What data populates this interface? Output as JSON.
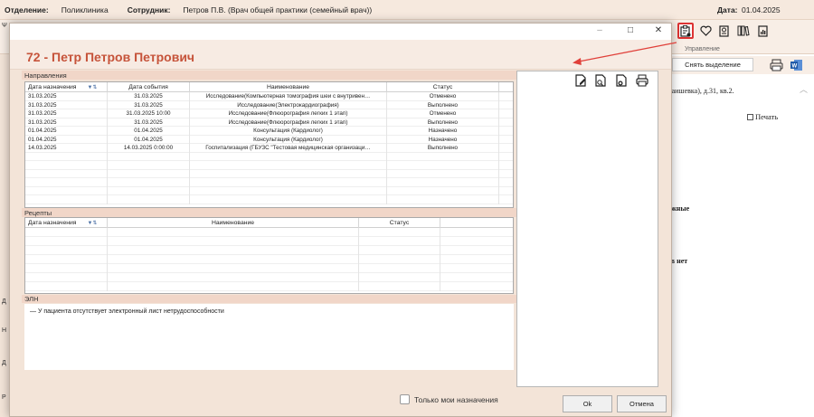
{
  "app": {
    "department_label": "Отделение:",
    "department_value": "Поликлиника",
    "employee_label": "Сотрудник:",
    "employee_value": "Петров П.В. (Врач общей практики (семейный врач))",
    "date_label": "Дата:",
    "date_value": "01.04.2025",
    "ribbon_group_label": "Управление",
    "clear_selection": "Снять выделение",
    "print_label": "Печать",
    "doc_lines": [
      "Баишевка), д.31, кв.2.",
      "ажные",
      "ов нет"
    ]
  },
  "modal": {
    "title": "72 - Петр Петров Петрович",
    "directions": {
      "label": "Направления",
      "columns": [
        "Дата назначения",
        "Дата события",
        "Наименование",
        "Статус"
      ],
      "rows": [
        [
          "31.03.2025",
          "31.03.2025",
          "Исследование(Компьютерная томография шеи с внутривен…",
          "Отменено"
        ],
        [
          "31.03.2025",
          "31.03.2025",
          "Исследование(Электрокардиография)",
          "Выполнено"
        ],
        [
          "31.03.2025",
          "31.03.2025 10:00",
          "Исследование(Флюорография легких 1 этап)",
          "Отменено"
        ],
        [
          "31.03.2025",
          "31.03.2025",
          "Исследование(Флюорография легких 1 этап)",
          "Выполнено"
        ],
        [
          "01.04.2025",
          "01.04.2025",
          "Консультация (Кардиолог)",
          "Назначено"
        ],
        [
          "01.04.2025",
          "01.04.2025",
          "Консультация (Кардиолог)",
          "Назначено"
        ],
        [
          "14.03.2025",
          "14.03.2025 0:00:00",
          "Госпитализация (ГБУЗС \"Тестовая медицинская организаци…",
          "Выполнено"
        ]
      ]
    },
    "recipes": {
      "label": "Рецепты",
      "columns": [
        "Дата назначения",
        "Наименование",
        "Статус"
      ]
    },
    "eln": {
      "label": "ЭЛН",
      "text": "У пациента отсутствует электронный лист нетрудоспособности"
    },
    "only_mine_label": "Только мои назначения",
    "ok_label": "Ok",
    "cancel_label": "Отмена"
  },
  "colors": {
    "title_accent": "#c6533a",
    "highlight_border": "#dd3333",
    "section_band": "#f1d6c8"
  },
  "icons": [
    "edit-document-icon",
    "search-document-icon",
    "delete-document-icon",
    "print-icon"
  ]
}
